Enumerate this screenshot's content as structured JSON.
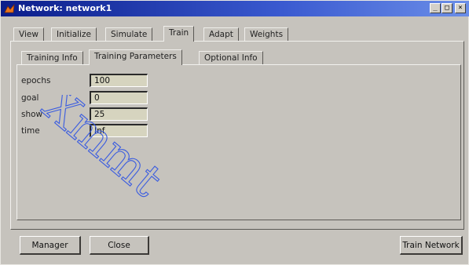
{
  "window": {
    "title": "Network: network1",
    "controls": {
      "minimize": "_",
      "maximize": "□",
      "close": "×"
    }
  },
  "main_tabs": [
    {
      "label": "View"
    },
    {
      "label": "Initialize"
    },
    {
      "label": "Simulate"
    },
    {
      "label": "Train",
      "active": true
    },
    {
      "label": "Adapt"
    },
    {
      "label": "Weights"
    }
  ],
  "sub_tabs": [
    {
      "label": "Training Info"
    },
    {
      "label": "Training Parameters",
      "active": true
    },
    {
      "label": "Optional Info"
    }
  ],
  "parameters": [
    {
      "label": "epochs",
      "value": "100"
    },
    {
      "label": "goal",
      "value": "0"
    },
    {
      "label": "show",
      "value": "25"
    },
    {
      "label": "time",
      "value": "Inf"
    }
  ],
  "buttons": {
    "manager": "Manager",
    "close": "Close",
    "train_network": "Train Network"
  },
  "watermark": {
    "text": "Xmmt",
    "color": "#3a5ce0"
  },
  "colors": {
    "window_bg": "#c6c3bd",
    "titlebar": "#0a1d8a",
    "input_bg": "#d6d4bf"
  }
}
